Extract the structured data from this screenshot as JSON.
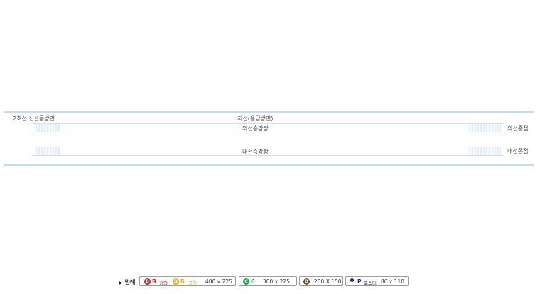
{
  "station": {
    "line_direction": "2호선 신설동방면",
    "branch_title": "지선(용답방면)",
    "outer_platform": "외선승강장",
    "inner_platform": "내선승강장",
    "outer_terminal": "외선종점",
    "inner_terminal": "내선종점"
  },
  "legend": {
    "title": "범례",
    "items": [
      {
        "badge": "B",
        "label": "B",
        "sub": "상업",
        "badge2": "B",
        "label2": "B",
        "sub2": "공익",
        "size": "400 x 225"
      },
      {
        "badge": "C",
        "label": "C",
        "size": "300 x 225"
      },
      {
        "badge": "D",
        "size": "200 X 150"
      },
      {
        "label": "P",
        "sub": "포스터",
        "size": "80 x 110"
      }
    ]
  },
  "colors": {
    "rail": "#c6dcec",
    "badge_b_commercial": "#e01b24",
    "badge_b_public": "#f2a900",
    "badge_c": "#1aa03a",
    "badge_d": "#7a4a1c",
    "poster": "#1a2a7a"
  }
}
